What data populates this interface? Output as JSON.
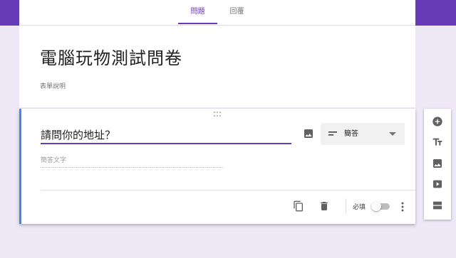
{
  "tabs": [
    {
      "label": "問題",
      "active": true
    },
    {
      "label": "回覆",
      "active": false
    }
  ],
  "form": {
    "title": "電腦玩物測試問卷",
    "description_placeholder": "表單說明"
  },
  "question": {
    "title": "請問你的地址？",
    "type_label": "簡答",
    "answer_placeholder": "簡答文字",
    "required_label": "必填",
    "required": false
  },
  "icons": {
    "drag": "drag-handle-icon",
    "image": "image-icon",
    "short_answer": "short-text-icon",
    "dropdown": "chevron-down-icon",
    "copy": "copy-icon",
    "delete": "trash-icon",
    "more": "more-vertical-icon",
    "side_toolbar": [
      "add-circle-icon",
      "title-text-icon",
      "image-icon",
      "video-icon",
      "section-icon"
    ]
  },
  "colors": {
    "primary": "#673ab7",
    "background": "#ede7f6",
    "active_card_border": "#4285f4"
  }
}
